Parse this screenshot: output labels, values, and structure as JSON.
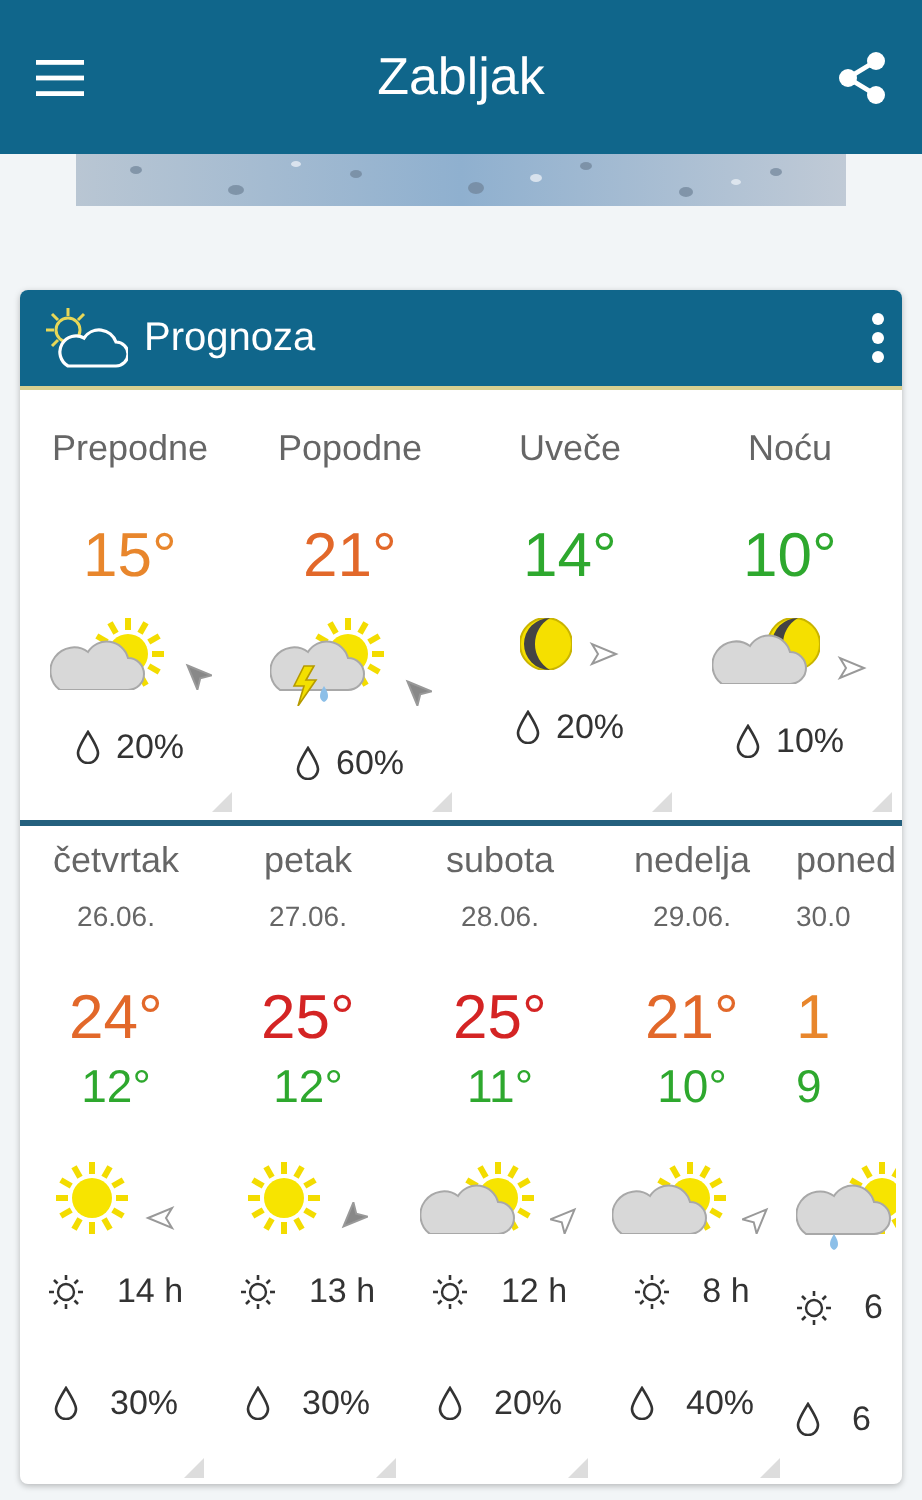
{
  "app_bar": {
    "title": "Zabljak"
  },
  "card": {
    "title": "Prognoza",
    "periods": [
      {
        "label": "Prepodne",
        "temp": "15°",
        "color": "#e8862c",
        "kind": "partly-sunny",
        "wind": {
          "kind": "nw",
          "strong": true
        },
        "rain": "20%"
      },
      {
        "label": "Popodne",
        "temp": "21°",
        "color": "#e2682a",
        "kind": "storm-sunny",
        "wind": {
          "kind": "nw",
          "strong": true
        },
        "rain": "60%"
      },
      {
        "label": "Uveče",
        "temp": "14°",
        "color": "#2ea82e",
        "kind": "moon",
        "wind": {
          "kind": "e",
          "strong": false
        },
        "rain": "20%"
      },
      {
        "label": "Noću",
        "temp": "10°",
        "color": "#2ea82e",
        "kind": "cloud-moon",
        "wind": {
          "kind": "e",
          "strong": false
        },
        "rain": "10%"
      }
    ],
    "days": [
      {
        "name": "četvrtak",
        "date": "26.06.",
        "high": "24°",
        "color": "#e2682a",
        "low": "12°",
        "kind": "sunny",
        "wind": {
          "kind": "w",
          "strong": false
        },
        "sun": "14 h",
        "rain": "30%"
      },
      {
        "name": "petak",
        "date": "27.06.",
        "high": "25°",
        "color": "#d42424",
        "low": "12°",
        "kind": "sunny",
        "wind": {
          "kind": "sw",
          "strong": true
        },
        "sun": "13 h",
        "rain": "30%"
      },
      {
        "name": "subota",
        "date": "28.06.",
        "high": "25°",
        "color": "#d42424",
        "low": "11°",
        "kind": "partly-sunny",
        "wind": {
          "kind": "ne",
          "strong": false
        },
        "sun": "12 h",
        "rain": "20%"
      },
      {
        "name": "nedelja",
        "date": "29.06.",
        "high": "21°",
        "color": "#e2682a",
        "low": "10°",
        "kind": "partly-sunny",
        "wind": {
          "kind": "ne",
          "strong": false
        },
        "sun": "8 h",
        "rain": "40%"
      },
      {
        "name": "poned",
        "date": "30.0",
        "high": "1",
        "color": "#e8862c",
        "low": "9",
        "kind": "rain-sunny",
        "sun": "6",
        "rain": "6"
      }
    ]
  }
}
